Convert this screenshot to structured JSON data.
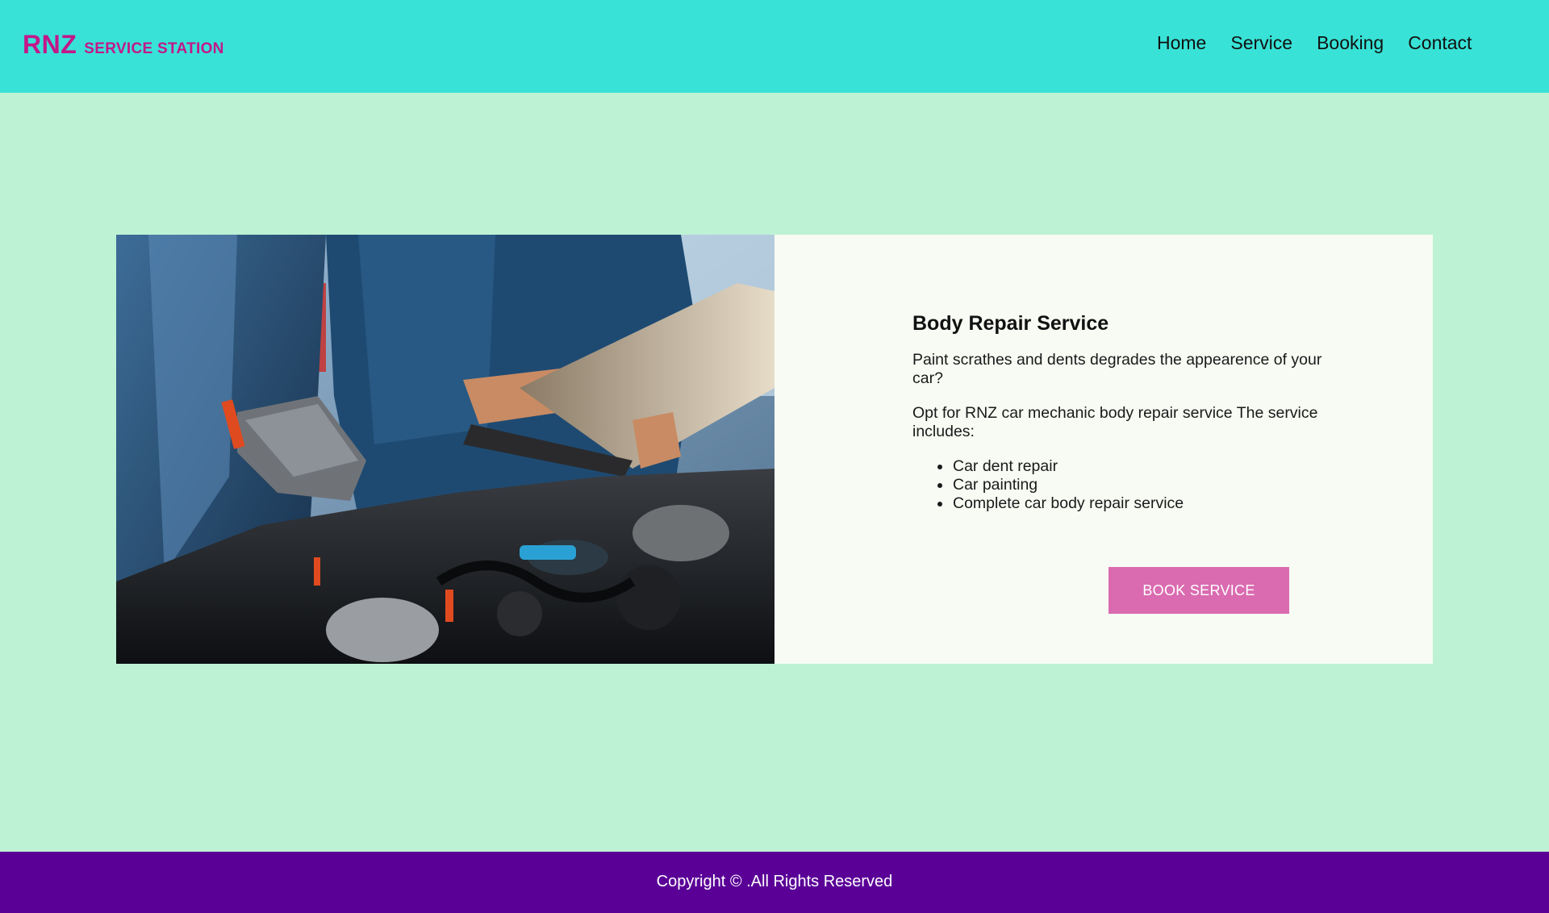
{
  "brand": {
    "name": "RNZ",
    "tagline": "SERVICE STATION"
  },
  "nav": {
    "items": [
      {
        "label": "Home"
      },
      {
        "label": "Service"
      },
      {
        "label": "Booking"
      },
      {
        "label": "Contact"
      }
    ]
  },
  "service": {
    "title": "Body Repair Service",
    "paragraph1": "Paint scrathes and dents degrades the appearence of your car?",
    "paragraph2": "Opt for RNZ car mechanic body repair service The service includes:",
    "items": [
      "Car dent repair",
      "Car painting",
      "Complete car body repair service"
    ],
    "button_label": "BOOK SERVICE"
  },
  "footer": {
    "copyright": "Copyright © .All Rights Reserved"
  },
  "colors": {
    "header_bg": "#38e2d6",
    "page_bg": "#bdf2d5",
    "brand": "#c2188a",
    "button": "#da6bb0",
    "footer_bg": "#5a0097"
  }
}
